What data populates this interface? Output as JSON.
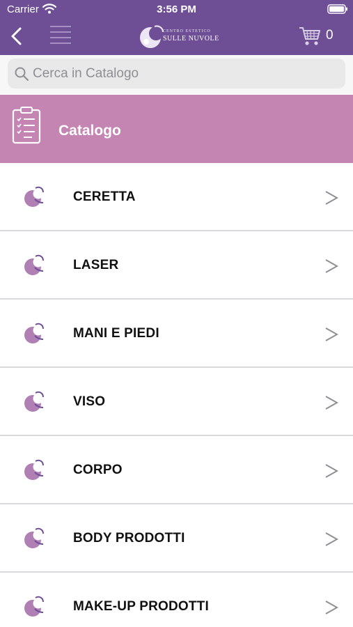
{
  "status_bar": {
    "carrier": "Carrier",
    "time": "3:56 PM"
  },
  "nav": {
    "back_icon": "chevron-left-icon",
    "menu_icon": "hamburger-icon",
    "logo_small": "CENTRO ESTETICO",
    "logo_big": "SULLE NUVOLE",
    "cart_icon": "cart-icon",
    "cart_count": "0"
  },
  "search": {
    "placeholder": "Cerca in Catalogo",
    "value": ""
  },
  "section": {
    "icon": "clipboard-checklist-icon",
    "title": "Catalogo"
  },
  "list": {
    "items": [
      {
        "label": "CERETTA",
        "chevron": ">"
      },
      {
        "label": "LASER",
        "chevron": ">"
      },
      {
        "label": "MANI E PIEDI",
        "chevron": ">"
      },
      {
        "label": "VISO",
        "chevron": ">"
      },
      {
        "label": "CORPO",
        "chevron": ">"
      },
      {
        "label": "BODY PRODOTTI",
        "chevron": ">"
      },
      {
        "label": "MAKE-UP PRODOTTI",
        "chevron": ">"
      }
    ]
  },
  "colors": {
    "header": "#6e4f96",
    "section": "#c485b2",
    "item_icon": "#b07fb4",
    "divider": "#d9d9dc"
  }
}
